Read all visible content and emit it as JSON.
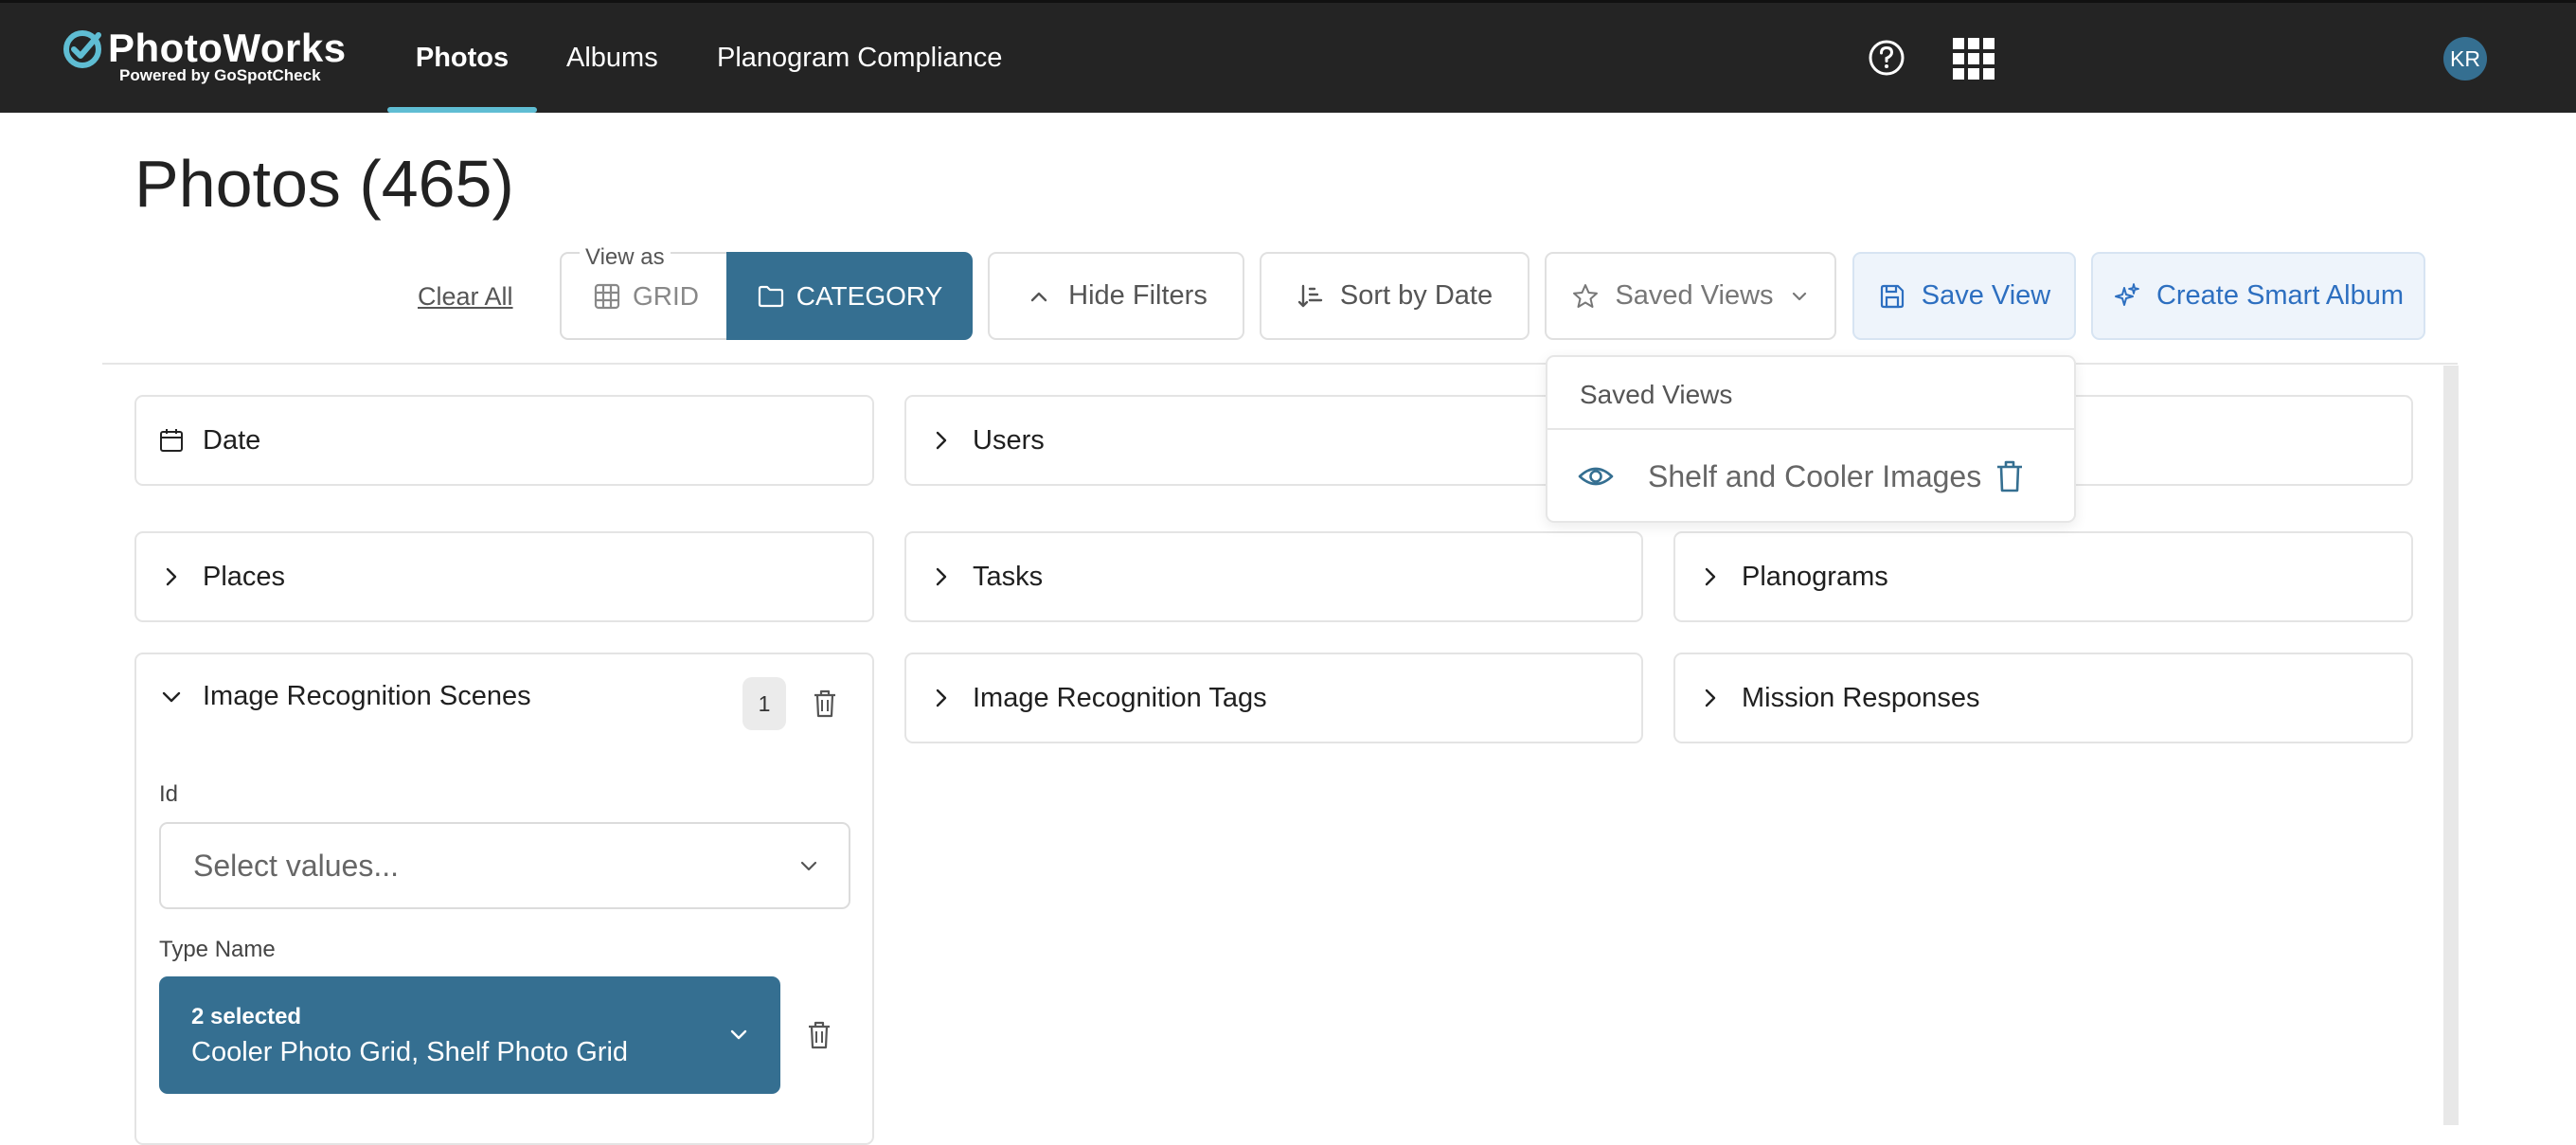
{
  "header": {
    "logo_name": "PhotoWorks",
    "logo_sub": "Powered by GoSpotCheck",
    "nav": [
      {
        "label": "Photos",
        "active": true
      },
      {
        "label": "Albums",
        "active": false
      },
      {
        "label": "Planogram Compliance",
        "active": false
      }
    ],
    "help_icon": "help-circle-icon",
    "apps_icon": "grid-apps-icon",
    "avatar_initials": "KR"
  },
  "page": {
    "title": "Photos (465)"
  },
  "toolbar": {
    "clear_all": "Clear All",
    "view_as_label": "View as",
    "grid_label": "GRID",
    "category_label": "CATEGORY",
    "hide_filters": "Hide Filters",
    "sort_by_date": "Sort by Date",
    "saved_views": "Saved Views",
    "save_view": "Save View",
    "create_smart_album": "Create Smart Album"
  },
  "saved_views_dropdown": {
    "title": "Saved Views",
    "items": [
      {
        "label": "Shelf and Cooler Images"
      }
    ]
  },
  "filters": {
    "date": "Date",
    "users": "Users",
    "places": "Places",
    "tasks": "Tasks",
    "planograms": "Planograms",
    "image_recognition_scenes": {
      "label": "Image Recognition Scenes",
      "count": "1",
      "id_label": "Id",
      "id_placeholder": "Select values...",
      "type_name_label": "Type Name",
      "type_name_count": "2 selected",
      "type_name_values": "Cooler Photo Grid, Shelf Photo Grid"
    },
    "image_recognition_tags": "Image Recognition Tags",
    "mission_responses": "Mission Responses"
  },
  "colors": {
    "topbar": "#242424",
    "accent_teal": "#5fbdd3",
    "primary_blue": "#356f91",
    "link_blue": "#2d6fc0"
  }
}
